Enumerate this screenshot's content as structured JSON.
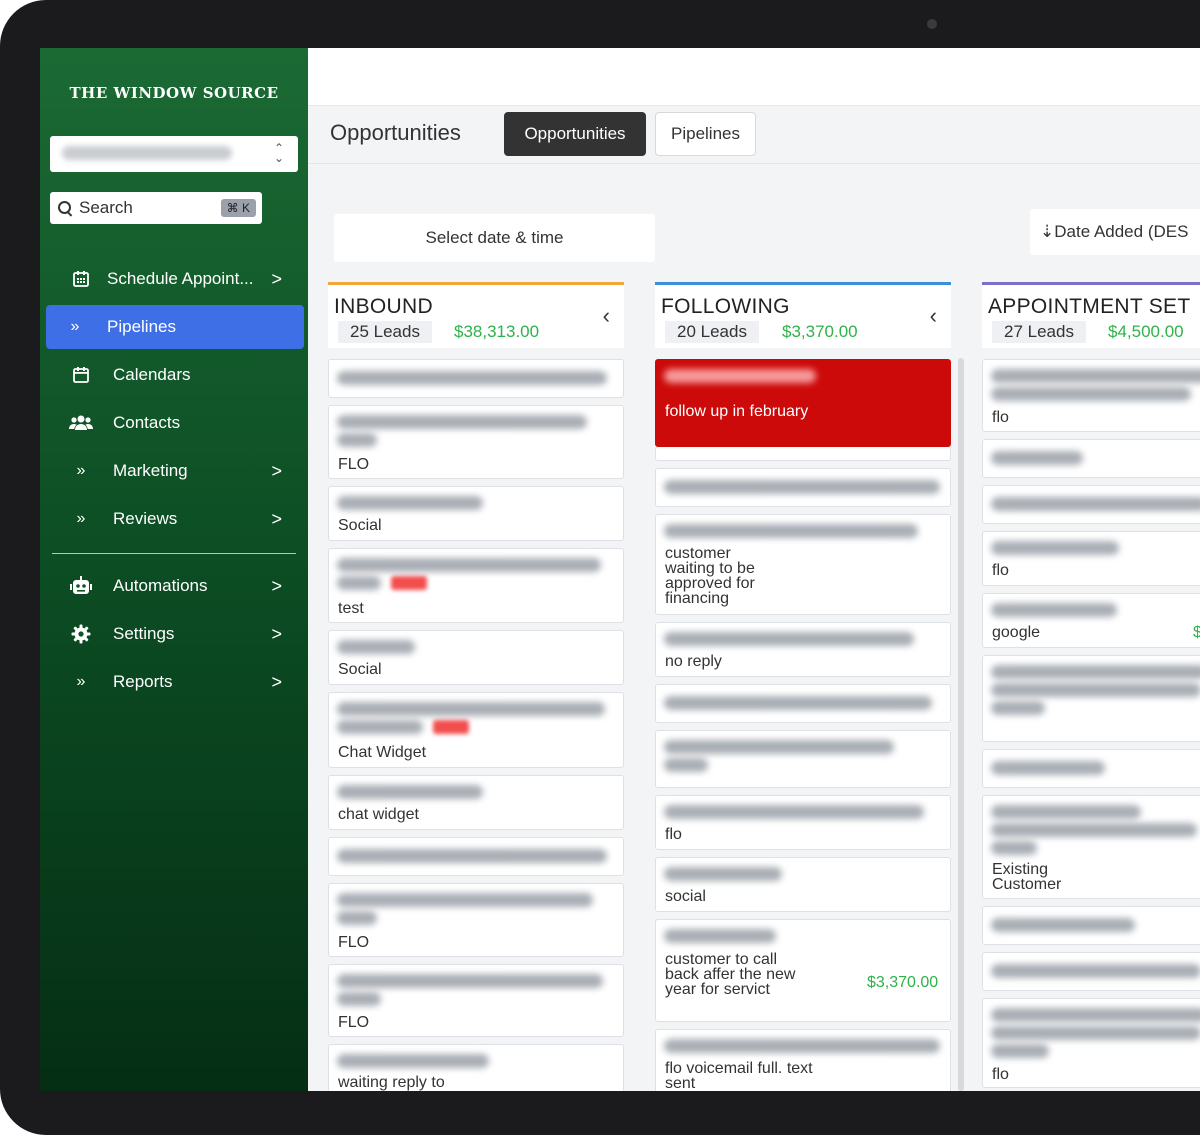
{
  "brand": "THE WINDOW SOURCE",
  "search": {
    "label": "Search",
    "shortcut": "⌘ K"
  },
  "nav": [
    {
      "label": "Schedule Appoint...",
      "icon": "calendar-grid-icon",
      "arrow": ">"
    },
    {
      "label": "Pipelines",
      "icon": "double-chevron-icon",
      "active": true
    },
    {
      "label": "Calendars",
      "icon": "calendar-icon"
    },
    {
      "label": "Contacts",
      "icon": "users-icon"
    },
    {
      "label": "Marketing",
      "icon": "double-chevron-icon",
      "arrow": ">"
    },
    {
      "label": "Reviews",
      "icon": "double-chevron-icon",
      "arrow": ">"
    },
    {
      "label": "Automations",
      "icon": "robot-icon",
      "arrow": ">"
    },
    {
      "label": "Settings",
      "icon": "gear-icon",
      "arrow": ">"
    },
    {
      "label": "Reports",
      "icon": "double-chevron-icon",
      "arrow": ">"
    }
  ],
  "header": {
    "title": "Opportunities",
    "tabs": [
      "Opportunities",
      "Pipelines"
    ]
  },
  "filters": {
    "date_placeholder": "Select date & time",
    "sort_label": "⇣Date Added (DES"
  },
  "columns": [
    {
      "name": "INBOUND",
      "leads": "25 Leads",
      "amount": "$38,313.00",
      "back": "‹",
      "accent": "#f2a53a",
      "cards": [
        {
          "sub": ""
        },
        {
          "sub": "FLO"
        },
        {
          "sub": "Social"
        },
        {
          "sub": "test"
        },
        {
          "sub": "Social"
        },
        {
          "sub": "Chat Widget"
        },
        {
          "sub": "chat widget"
        },
        {
          "sub": ""
        },
        {
          "sub": "FLO"
        },
        {
          "sub": "FLO"
        },
        {
          "sub": "waiting reply to"
        }
      ]
    },
    {
      "name": "FOLLOWING",
      "leads": "20 Leads",
      "amount": "$3,370.00",
      "back": "‹",
      "accent": "#3a8fd8",
      "cards": [
        {
          "sub": "follow up in february"
        },
        {
          "sub": ""
        },
        {
          "sub": ""
        },
        {
          "sub": "customer waiting to be approved for financing"
        },
        {
          "sub": "no reply"
        },
        {
          "sub": ""
        },
        {
          "sub": ""
        },
        {
          "sub": "flo"
        },
        {
          "sub": "social"
        },
        {
          "sub": "customer to call back affer the new year for servict",
          "amount": "$3,370.00"
        },
        {
          "sub": "flo voicemail full. text sent"
        }
      ]
    },
    {
      "name": "APPOINTMENT SET",
      "leads": "27 Leads",
      "amount": "$4,500.00",
      "accent": "#7b6fc9",
      "cards": [
        {
          "sub": "flo"
        },
        {
          "sub": ""
        },
        {
          "sub": ""
        },
        {
          "sub": "flo"
        },
        {
          "sub": "google",
          "amount": "$"
        },
        {
          "sub": ""
        },
        {
          "sub": ""
        },
        {
          "sub": "Existing Customer"
        },
        {
          "sub": ""
        },
        {
          "sub": ""
        },
        {
          "sub": "flo"
        }
      ]
    }
  ]
}
